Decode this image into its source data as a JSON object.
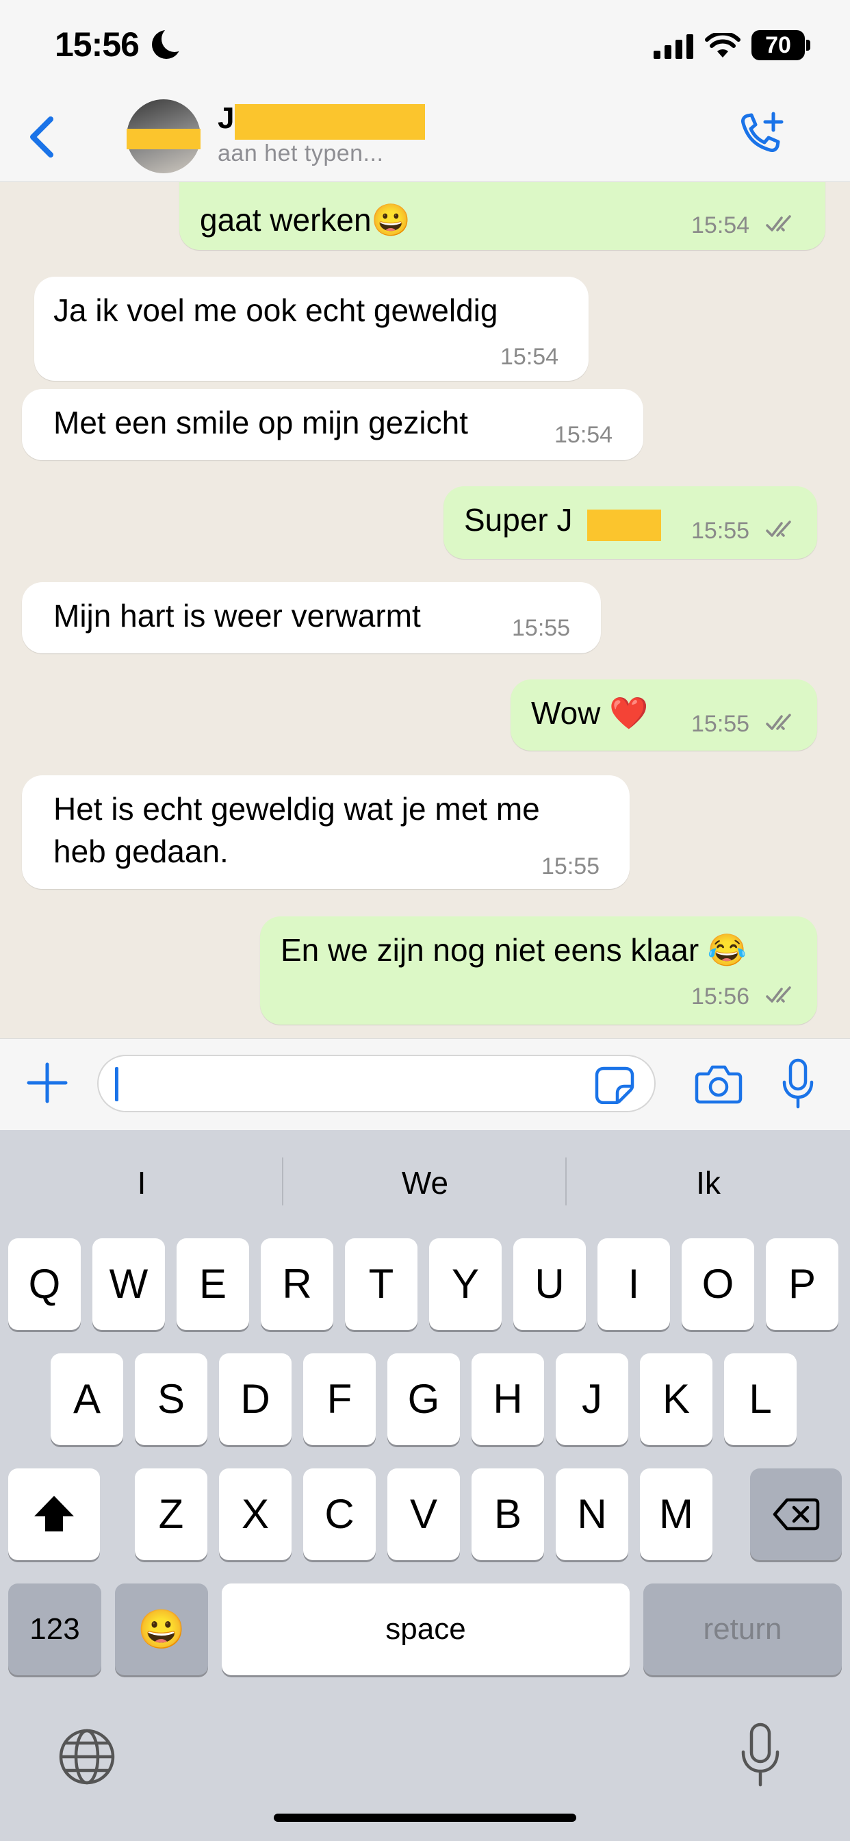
{
  "status_bar": {
    "time": "15:56",
    "battery": "70"
  },
  "header": {
    "contact_initial": "J",
    "status": "aan het typen..."
  },
  "messages": [
    {
      "dir": "out",
      "text": "gaat werken😀",
      "time": "15:54"
    },
    {
      "dir": "in",
      "text": "Ja ik voel me ook echt geweldig",
      "time": "15:54"
    },
    {
      "dir": "in",
      "text": "Met een smile op mijn gezicht",
      "time": "15:54"
    },
    {
      "dir": "out",
      "text": "Super J",
      "time": "15:55"
    },
    {
      "dir": "in",
      "text": "Mijn hart is weer verwarmt",
      "time": "15:55"
    },
    {
      "dir": "out",
      "text": "Wow ❤️",
      "time": "15:55"
    },
    {
      "dir": "in",
      "line1": "Het is echt geweldig wat je met me",
      "line2": "heb gedaan.",
      "time": "15:55"
    },
    {
      "dir": "out",
      "text": "En we zijn nog niet eens klaar 😂",
      "time": "15:56"
    }
  ],
  "keyboard": {
    "suggestions": [
      "I",
      "We",
      "Ik"
    ],
    "row1": [
      "Q",
      "W",
      "E",
      "R",
      "T",
      "Y",
      "U",
      "I",
      "O",
      "P"
    ],
    "row2": [
      "A",
      "S",
      "D",
      "F",
      "G",
      "H",
      "J",
      "K",
      "L"
    ],
    "row3": [
      "Z",
      "X",
      "C",
      "V",
      "B",
      "N",
      "M"
    ],
    "numbers_label": "123",
    "emoji_label": "😀",
    "space_label": "space",
    "return_label": "return"
  },
  "colors": {
    "accent": "#1a73e8",
    "outgoing_bubble": "#dcf8c6",
    "incoming_bubble": "#ffffff",
    "chat_background": "#efeae2",
    "redaction": "#fbc52d",
    "read_ticks": "#8a8a8a"
  }
}
